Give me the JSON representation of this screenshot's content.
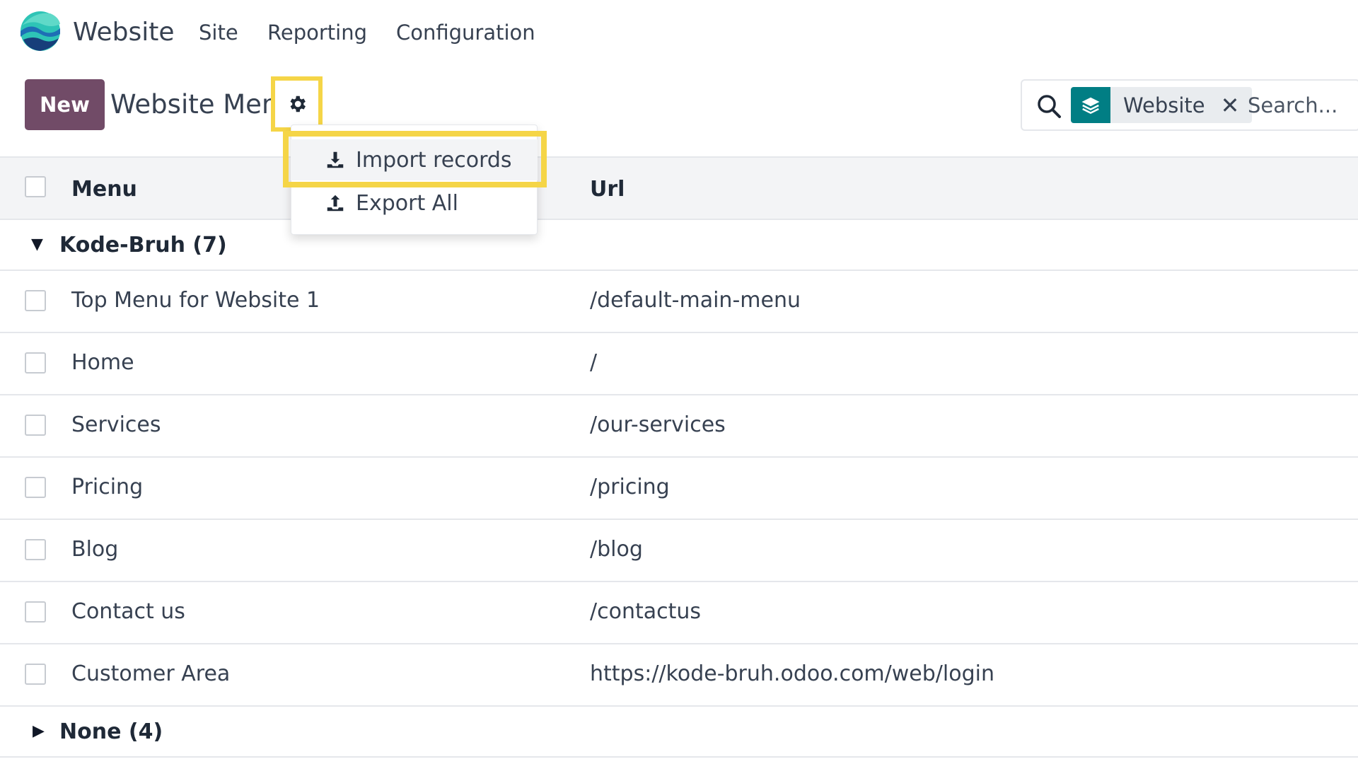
{
  "navbar": {
    "app_name": "Website",
    "items": [
      {
        "label": "Site"
      },
      {
        "label": "Reporting"
      },
      {
        "label": "Configuration"
      }
    ]
  },
  "control_panel": {
    "new_label": "New",
    "title": "Website Menu",
    "gear_icon": "gear-icon"
  },
  "search": {
    "facet_icon": "layers-icon",
    "facet_label": "Website",
    "placeholder": "Search..."
  },
  "actions_menu": {
    "items": [
      {
        "label": "Import records",
        "icon": "download-icon"
      },
      {
        "label": "Export All",
        "icon": "upload-icon"
      }
    ]
  },
  "table": {
    "columns": [
      "Menu",
      "Url"
    ],
    "groups": [
      {
        "label": "Kode-Bruh (7)",
        "expanded": true,
        "rows": [
          {
            "menu": "Top Menu for Website 1",
            "url": "/default-main-menu"
          },
          {
            "menu": "Home",
            "url": "/"
          },
          {
            "menu": "Services",
            "url": "/our-services"
          },
          {
            "menu": "Pricing",
            "url": "/pricing"
          },
          {
            "menu": "Blog",
            "url": "/blog"
          },
          {
            "menu": "Contact us",
            "url": "/contactus"
          },
          {
            "menu": "Customer Area",
            "url": "https://kode-bruh.odoo.com/web/login"
          }
        ]
      },
      {
        "label": "None (4)",
        "expanded": false,
        "rows": []
      }
    ]
  },
  "colors": {
    "primary": "#714b67",
    "facet": "#017e84",
    "highlight": "#f5d547"
  }
}
